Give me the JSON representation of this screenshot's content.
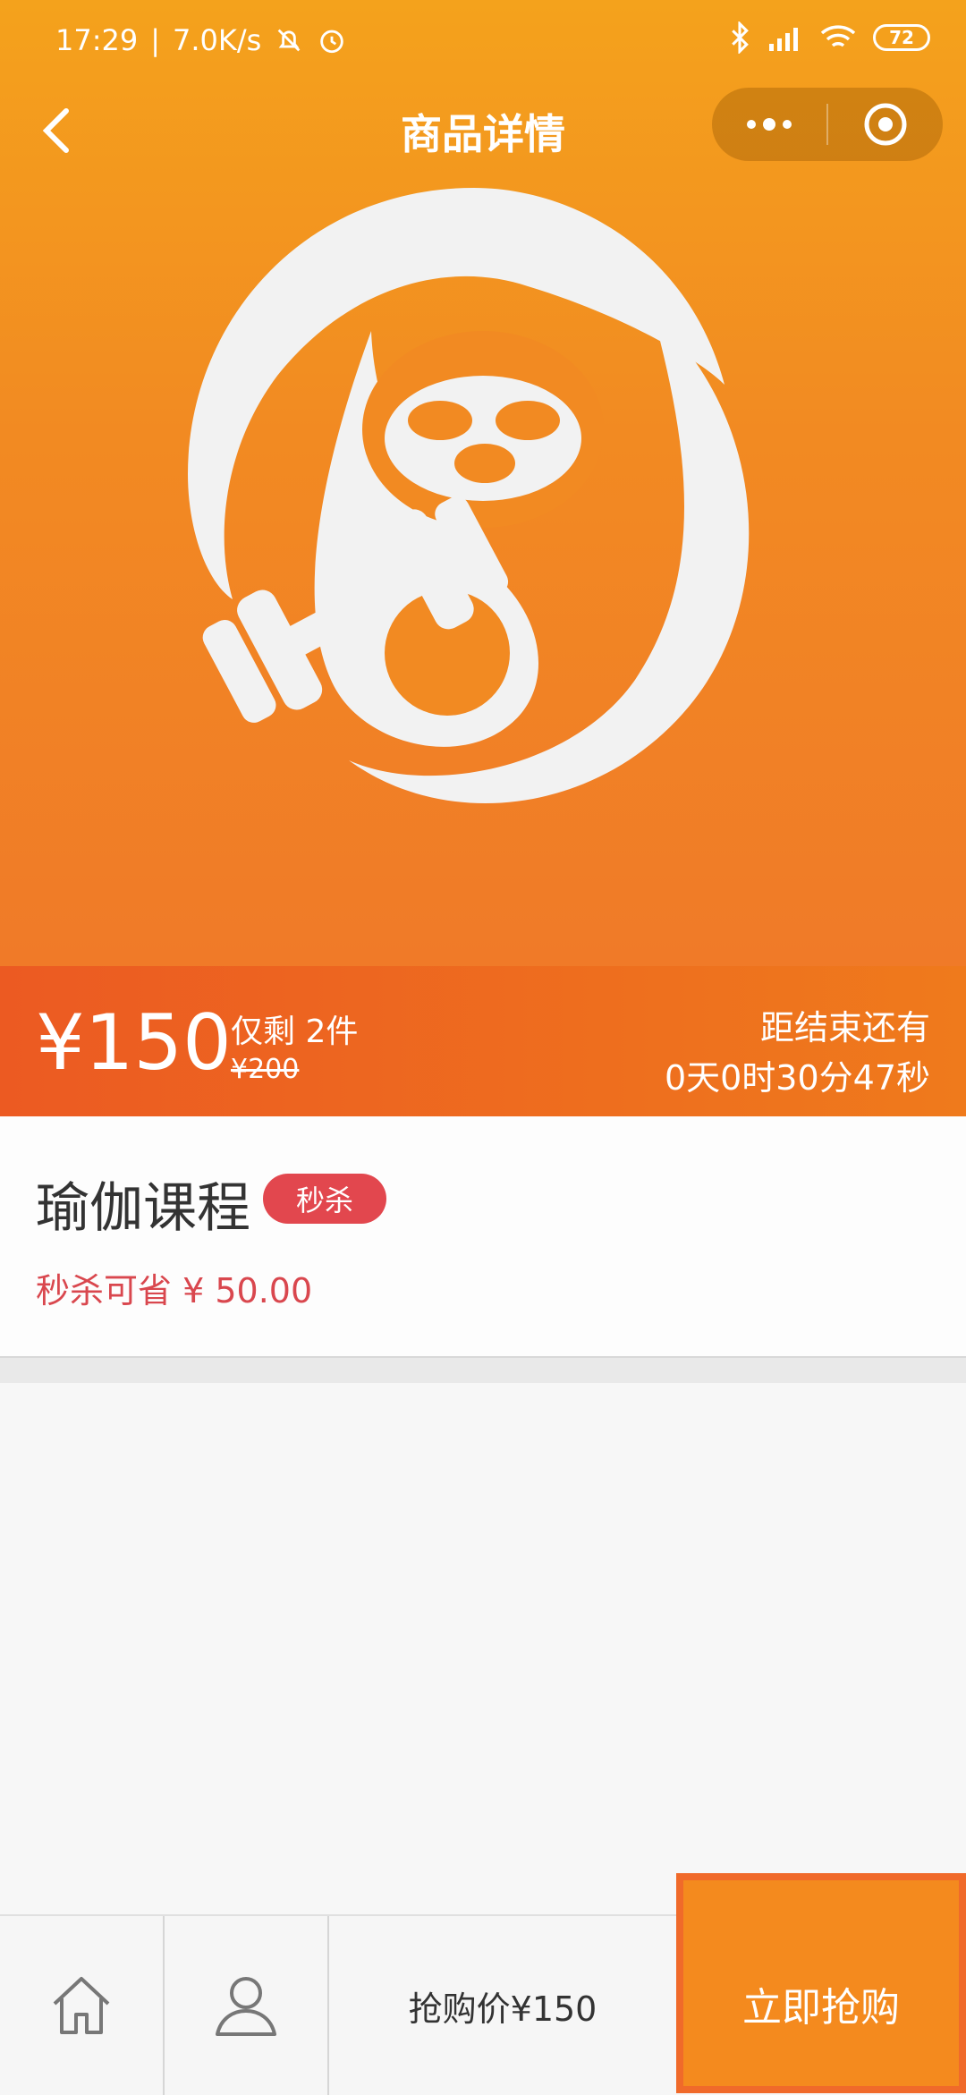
{
  "status_bar": {
    "time": "17:29",
    "net_speed": "7.0K/s",
    "battery": "72"
  },
  "nav": {
    "title": "商品详情"
  },
  "price_bar": {
    "price": "¥150",
    "stock": "仅剩 2件",
    "original_price": "¥200",
    "countdown_label": "距结束还有",
    "countdown_value": "0天0时30分47秒"
  },
  "product": {
    "name": "瑜伽课程",
    "badge": "秒杀",
    "save_text": "秒杀可省 ¥ 50.00"
  },
  "bottom_bar": {
    "buy_price": "抢购价¥150",
    "buy_button": "立即抢购"
  },
  "colors": {
    "header_orange": "#f4a21c",
    "accent_red": "#e2474e",
    "buy_orange": "#f48a1e"
  }
}
